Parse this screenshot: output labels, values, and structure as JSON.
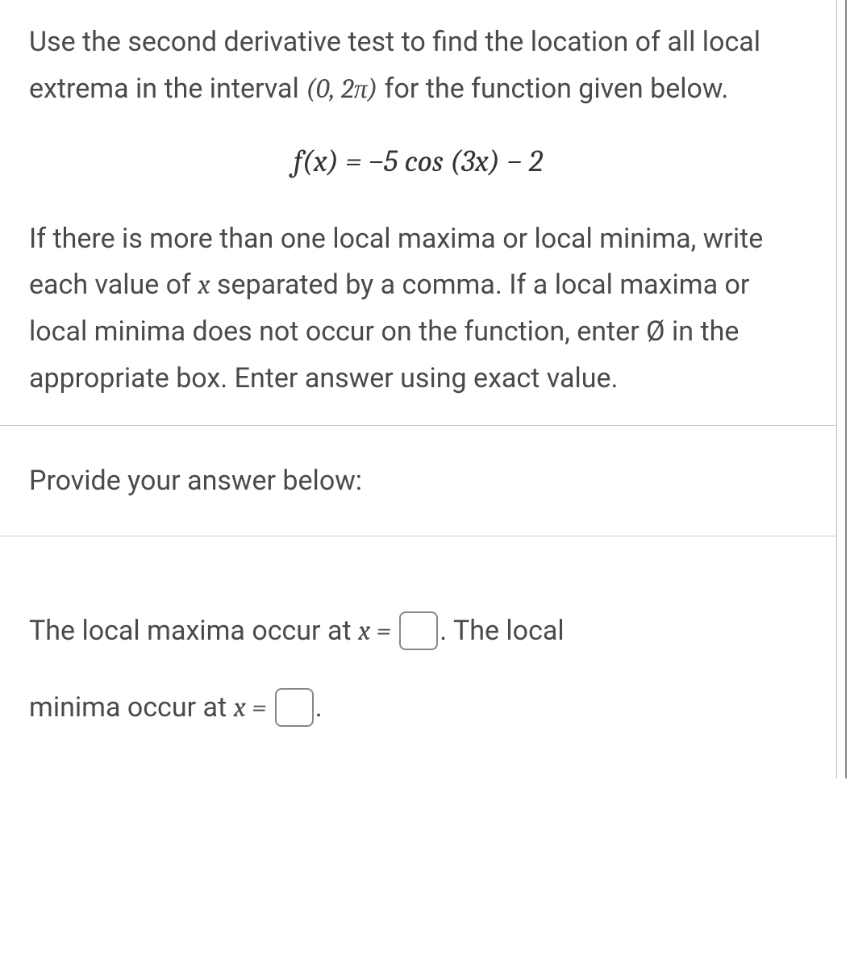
{
  "question": {
    "part1_pre": "Use the second derivative test to find the location of all local extrema in the interval ",
    "interval": "(0, 2π)",
    "part1_post": " for the function given below.",
    "equation": "f(x) = −5 cos (3x) − 2",
    "part2_pre": "If there is more than one local maxima or local minima, write each value of ",
    "var_x": "x",
    "part2_mid": " separated by a comma. If a local maxima or local minima does not occur on the function, enter ",
    "empty_symbol": "Ø",
    "part2_post": " in the appropriate box. Enter answer using exact value."
  },
  "prompt": {
    "label": "Provide your answer below:"
  },
  "answer": {
    "maxima_pre": "The local maxima occur at ",
    "x_eq": "x =",
    "maxima_post": ". The local",
    "minima_pre": "minima occur at ",
    "minima_post": "."
  },
  "inputs": {
    "maxima_value": "",
    "minima_value": ""
  }
}
